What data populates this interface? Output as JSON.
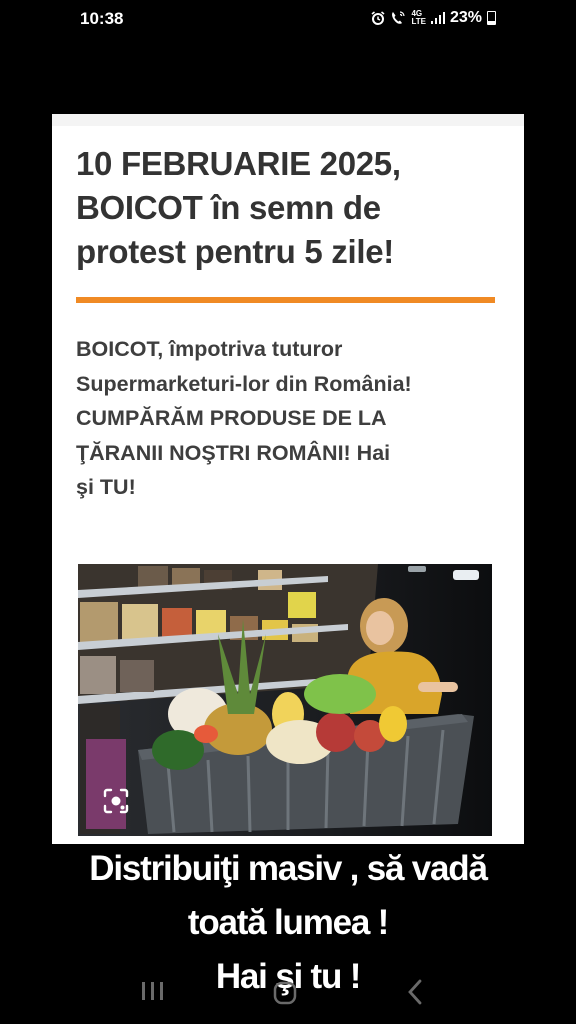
{
  "status_bar": {
    "time": "10:38",
    "network_top": "4G",
    "network_bottom": "LTE",
    "battery": "23%",
    "icons": [
      "alarm-icon",
      "call-icon",
      "signal-icon",
      "battery-icon"
    ]
  },
  "article": {
    "headline_lines": [
      "10 FEBRUARIE 2025,",
      "BOICOT în semn de",
      "protest pentru 5 zile!"
    ],
    "accent_color": "#f08a24",
    "body_lines": [
      "BOICOT, împotriva tuturor",
      "Supermarketuri-lor din România!",
      "CUMPĂRĂM PRODUSE DE LA",
      "ŢĂRANII NOŞTRI ROMÂNI! Hai",
      "şi TU!"
    ],
    "image_icon": "lens-search-icon"
  },
  "caption": {
    "lines": [
      "Distribuiţi masiv  , să vadă",
      "toată lumea !",
      "Hai şi tu !"
    ]
  },
  "nav_bar": {
    "icons": [
      "recents-icon",
      "home-icon",
      "back-icon"
    ]
  }
}
